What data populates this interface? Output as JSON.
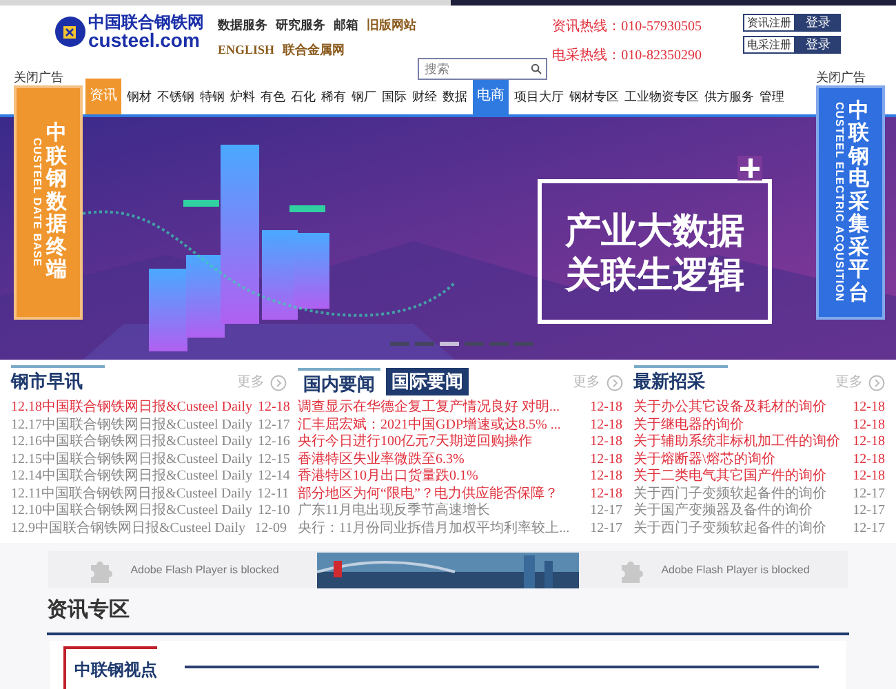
{
  "logo": {
    "name": "中国联合钢铁网",
    "domain": "custeel.com"
  },
  "top_links": [
    {
      "text": "数据服务",
      "color": "#333333"
    },
    {
      "text": "研究服务",
      "color": "#333333"
    },
    {
      "text": "邮箱",
      "color": "#333333"
    },
    {
      "text": "旧版网站",
      "color": "#8a5a1c"
    },
    {
      "text": "ENGLISH",
      "color": "#8a5a1c"
    },
    {
      "text": "联合金属网",
      "color": "#8a5a1c"
    }
  ],
  "hotlines": [
    "资讯热线：010-57930505",
    "电采热线：010-82350290"
  ],
  "accounts": [
    {
      "register": "资讯注册",
      "login": "登录"
    },
    {
      "register": "电采注册",
      "login": "登录"
    }
  ],
  "search": {
    "placeholder": "搜索"
  },
  "nav": [
    {
      "label": "资讯",
      "selected": true,
      "color": "#f0962e"
    },
    {
      "label": "钢材",
      "selected": false
    },
    {
      "label": "不锈钢",
      "selected": false
    },
    {
      "label": "特钢",
      "selected": false
    },
    {
      "label": "炉料",
      "selected": false
    },
    {
      "label": "有色",
      "selected": false
    },
    {
      "label": "石化",
      "selected": false
    },
    {
      "label": "稀有",
      "selected": false
    },
    {
      "label": "钢厂",
      "selected": false
    },
    {
      "label": "国际",
      "selected": false
    },
    {
      "label": "财经",
      "selected": false
    },
    {
      "label": "数据",
      "selected": false
    },
    {
      "label": "电商",
      "selected": true,
      "color": "#2f7ae0"
    },
    {
      "label": "项目大厅",
      "selected": false
    },
    {
      "label": "钢材专区",
      "selected": false
    },
    {
      "label": "工业物资专区",
      "selected": false
    },
    {
      "label": "供方服务",
      "selected": false
    },
    {
      "label": "管理",
      "selected": false
    }
  ],
  "ads": [
    {
      "close": "关闭广告",
      "title": "中联钢数据终端",
      "subtitle": "CUSTEEL DATE BASE",
      "color": "#f0962e"
    },
    {
      "close": "关闭广告",
      "title": "中联钢电采集采平台",
      "subtitle": "CUSTEEL ELECTRIC ACQUSITION",
      "color": "#2f6fe0"
    }
  ],
  "banner": {
    "headline": [
      "产业大数据",
      "关联生逻辑"
    ],
    "dots": [
      {
        "selected": false
      },
      {
        "selected": false
      },
      {
        "selected": true
      },
      {
        "selected": false
      },
      {
        "selected": false
      },
      {
        "selected": false
      }
    ]
  },
  "news": [
    {
      "title": "钢市早讯",
      "more": "更多",
      "items": [
        {
          "title": "12.18中国联合钢铁网日报&Custeel Daily",
          "date": "12-18",
          "new": true
        },
        {
          "title": "12.17中国联合钢铁网日报&Custeel Daily",
          "date": "12-17",
          "new": false
        },
        {
          "title": "12.16中国联合钢铁网日报&Custeel Daily",
          "date": "12-16",
          "new": false
        },
        {
          "title": "12.15中国联合钢铁网日报&Custeel Daily",
          "date": "12-15",
          "new": false
        },
        {
          "title": "12.14中国联合钢铁网日报&Custeel Daily",
          "date": "12-14",
          "new": false
        },
        {
          "title": "12.11中国联合钢铁网日报&Custeel Daily",
          "date": "12-11",
          "new": false
        },
        {
          "title": "12.10中国联合钢铁网日报&Custeel Daily",
          "date": "12-10",
          "new": false
        },
        {
          "title": "12.9中国联合钢铁网日报&Custeel Daily",
          "date": "12-09",
          "new": false
        }
      ]
    },
    {
      "tabs": [
        {
          "label": "国内要闻",
          "selected": false
        },
        {
          "label": "国际要闻",
          "selected": true
        }
      ],
      "more": "更多",
      "items": [
        {
          "title": "调查显示在华德企复工复产情况良好 对明...",
          "date": "12-18",
          "new": true
        },
        {
          "title": "汇丰屈宏斌：2021中国GDP增速或达8.5% ...",
          "date": "12-18",
          "new": true
        },
        {
          "title": "央行今日进行100亿元7天期逆回购操作",
          "date": "12-18",
          "new": true
        },
        {
          "title": "香港特区失业率微跌至6.3%",
          "date": "12-18",
          "new": true
        },
        {
          "title": "香港特区10月出口货量跌0.1%",
          "date": "12-18",
          "new": true
        },
        {
          "title": "部分地区为何“限电”？电力供应能否保障？",
          "date": "12-18",
          "new": true
        },
        {
          "title": "广东11月电出现反季节高速增长",
          "date": "12-17",
          "new": false
        },
        {
          "title": "央行：11月份同业拆借月加权平均利率较上...",
          "date": "12-17",
          "new": false
        }
      ]
    },
    {
      "title": "最新招采",
      "more": "更多",
      "items": [
        {
          "title": "关于办公其它设备及耗材的询价",
          "date": "12-18",
          "new": true
        },
        {
          "title": "关于继电器的询价",
          "date": "12-18",
          "new": true
        },
        {
          "title": "关于辅助系统非标机加工件的询价",
          "date": "12-18",
          "new": true
        },
        {
          "title": "关于熔断器\\熔芯的询价",
          "date": "12-18",
          "new": true
        },
        {
          "title": "关于二类电气其它国产件的询价",
          "date": "12-18",
          "new": true
        },
        {
          "title": "关于西门子变频软起备件的询价",
          "date": "12-17",
          "new": false
        },
        {
          "title": "关于国产变频器及备件的询价",
          "date": "12-17",
          "new": false
        },
        {
          "title": "关于西门子变频软起备件的询价",
          "date": "12-17",
          "new": false
        }
      ]
    }
  ],
  "flash": [
    "Adobe Flash Player is blocked",
    "Adobe Flash Player is blocked"
  ],
  "section": {
    "title": "资讯专区",
    "card_title": "中联钢视点"
  }
}
